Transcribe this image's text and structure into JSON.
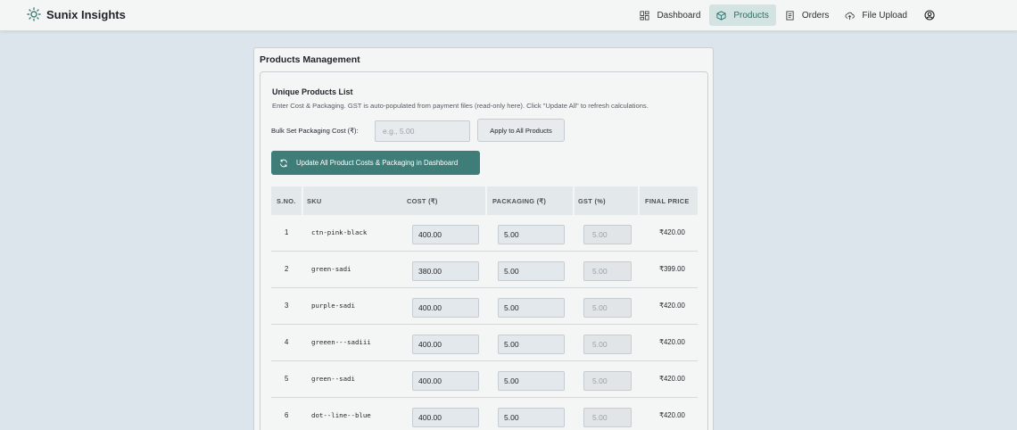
{
  "app": {
    "name": "Sunix Insights"
  },
  "nav": {
    "items": [
      {
        "label": "Dashboard",
        "icon": "dashboard-icon",
        "active": false
      },
      {
        "label": "Products",
        "icon": "box-icon",
        "active": true
      },
      {
        "label": "Orders",
        "icon": "receipt-icon",
        "active": false
      },
      {
        "label": "File Upload",
        "icon": "upload-cloud-icon",
        "active": false
      }
    ]
  },
  "card": {
    "title": "Products Management"
  },
  "section": {
    "title": "Unique Products List",
    "description": "Enter Cost & Packaging. GST is auto-populated from payment files (read-only here). Click \"Update All\" to refresh calculations."
  },
  "bulk": {
    "label": "Bulk Set Packaging Cost (₹):",
    "placeholder": "e.g., 5.00",
    "apply_label": "Apply to All Products"
  },
  "update_button": {
    "label": "Update All Product Costs & Packaging in Dashboard"
  },
  "table": {
    "headers": [
      "S.NO.",
      "SKU",
      "COST (₹)",
      "PACKAGING (₹)",
      "GST (%)",
      "FINAL PRICE"
    ],
    "rows": [
      {
        "no": "1",
        "sku": "ctn-pink-black",
        "cost": "400.00",
        "packaging": "5.00",
        "gst": "5.00",
        "final": "₹420.00"
      },
      {
        "no": "2",
        "sku": "green-sadi",
        "cost": "380.00",
        "packaging": "5.00",
        "gst": "5.00",
        "final": "₹399.00"
      },
      {
        "no": "3",
        "sku": "purple-sadi",
        "cost": "400.00",
        "packaging": "5.00",
        "gst": "5.00",
        "final": "₹420.00"
      },
      {
        "no": "4",
        "sku": "greeen---sadiii",
        "cost": "400.00",
        "packaging": "5.00",
        "gst": "5.00",
        "final": "₹420.00"
      },
      {
        "no": "5",
        "sku": "green--sadi",
        "cost": "400.00",
        "packaging": "5.00",
        "gst": "5.00",
        "final": "₹420.00"
      },
      {
        "no": "6",
        "sku": "dot--line--blue",
        "cost": "400.00",
        "packaging": "5.00",
        "gst": "5.00",
        "final": "₹420.00"
      }
    ]
  },
  "colors": {
    "accent": "#3f7d78",
    "nav_active_bg": "#d3e3e1",
    "page_bg": "#dde5ec"
  }
}
